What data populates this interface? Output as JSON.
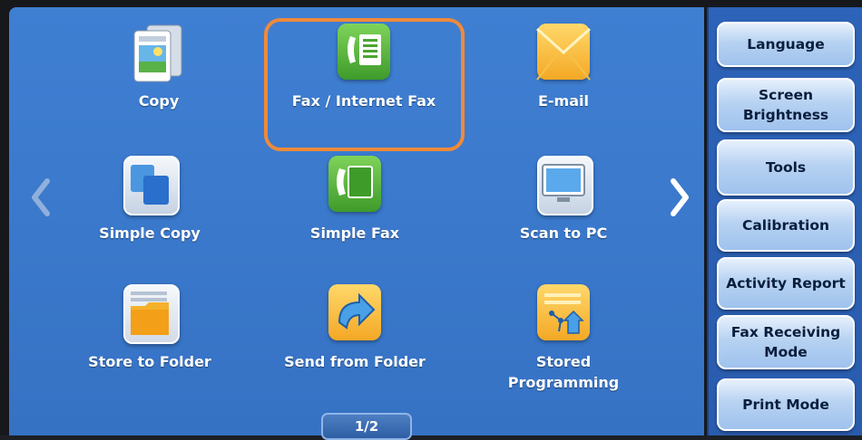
{
  "apps": [
    {
      "id": "copy",
      "label": "Copy",
      "icon": "copy-icon"
    },
    {
      "id": "fax",
      "label": "Fax / Internet Fax",
      "icon": "fax-icon"
    },
    {
      "id": "email",
      "label": "E-mail",
      "icon": "envelope-icon"
    },
    {
      "id": "simple-copy",
      "label": "Simple Copy",
      "icon": "simple-copy-icon"
    },
    {
      "id": "simple-fax",
      "label": "Simple Fax",
      "icon": "simple-fax-icon"
    },
    {
      "id": "scan-pc",
      "label": "Scan to PC",
      "icon": "monitor-icon"
    },
    {
      "id": "store-folder",
      "label": "Store to Folder",
      "icon": "folder-icon"
    },
    {
      "id": "send-folder",
      "label": "Send from Folder",
      "icon": "send-folder-icon"
    },
    {
      "id": "stored-prog",
      "label": "Stored\nProgramming",
      "icon": "stored-programming-icon"
    }
  ],
  "pager": {
    "label": "1/2"
  },
  "side_buttons": [
    {
      "id": "language",
      "label": "Language"
    },
    {
      "id": "screen-brightness",
      "label": "Screen\nBrightness"
    },
    {
      "id": "tools",
      "label": "Tools"
    },
    {
      "id": "calibration",
      "label": "Calibration"
    },
    {
      "id": "activity-report",
      "label": "Activity Report"
    },
    {
      "id": "fax-receiving",
      "label": "Fax Receiving\nMode"
    },
    {
      "id": "print-mode",
      "label": "Print Mode"
    }
  ],
  "colors": {
    "background": "#3a78cb",
    "highlight": "#ef8a3a",
    "side_panel": "#2b5fb3"
  }
}
